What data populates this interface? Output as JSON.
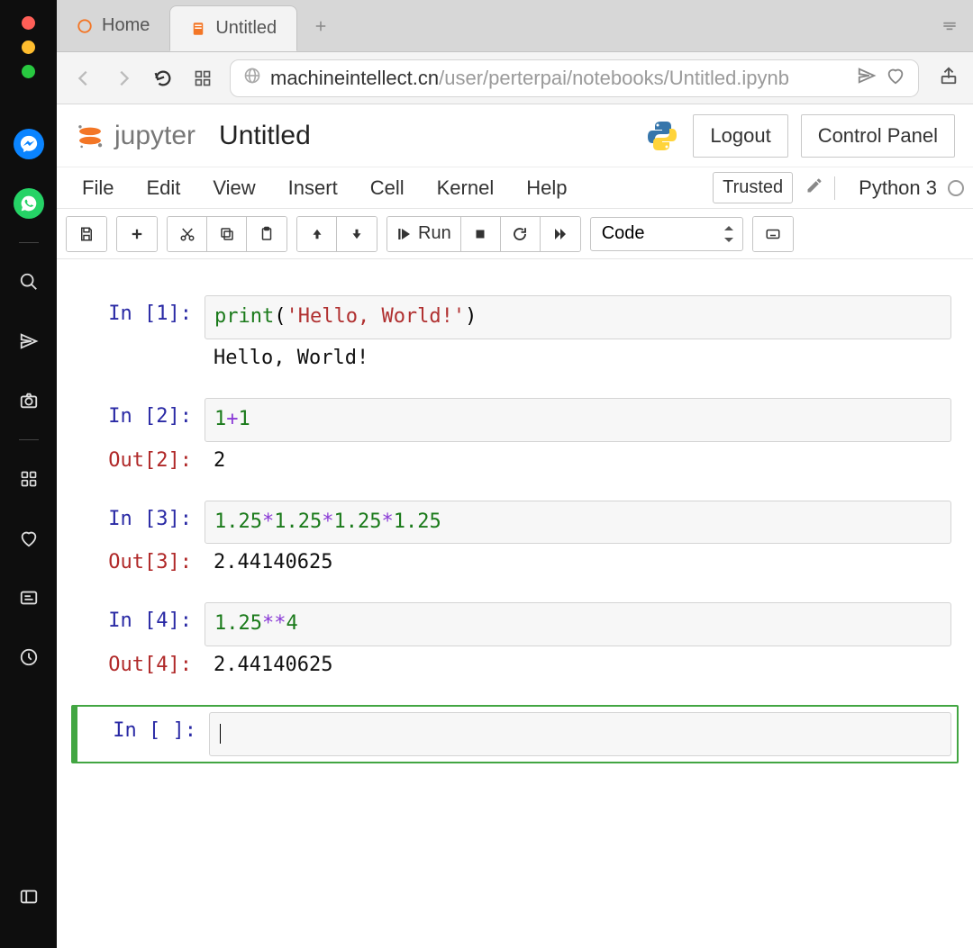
{
  "tabs": {
    "home": "Home",
    "notebook": "Untitled"
  },
  "url": {
    "host": "machineintellect.cn",
    "path": "/user/perterpai/notebooks/Untitled.ipynb"
  },
  "jupyter": {
    "brand": "jupyter",
    "title": "Untitled",
    "logout": "Logout",
    "control_panel": "Control Panel",
    "menu": {
      "file": "File",
      "edit": "Edit",
      "view": "View",
      "insert": "Insert",
      "cell": "Cell",
      "kernel": "Kernel",
      "help": "Help"
    },
    "trusted": "Trusted",
    "kernel_name": "Python 3",
    "toolbar": {
      "run": "Run",
      "celltype": "Code"
    }
  },
  "cells": [
    {
      "in_prompt": "In [1]:",
      "code": {
        "func": "print",
        "lparen": "(",
        "str": "'Hello, World!'",
        "rparen": ")"
      },
      "stdout_prompt": "",
      "stdout": "Hello, World!"
    },
    {
      "in_prompt": "In [2]:",
      "code": {
        "a": "1",
        "op": "+",
        "b": "1"
      },
      "out_prompt": "Out[2]:",
      "out": "2"
    },
    {
      "in_prompt": "In [3]:",
      "code": {
        "n1": "1.25",
        "o1": "*",
        "n2": "1.25",
        "o2": "*",
        "n3": "1.25",
        "o3": "*",
        "n4": "1.25"
      },
      "out_prompt": "Out[3]:",
      "out": "2.44140625"
    },
    {
      "in_prompt": "In [4]:",
      "code": {
        "n": "1.25",
        "op": "**",
        "e": "4"
      },
      "out_prompt": "Out[4]:",
      "out": "2.44140625"
    },
    {
      "in_prompt": "In [ ]:"
    }
  ]
}
